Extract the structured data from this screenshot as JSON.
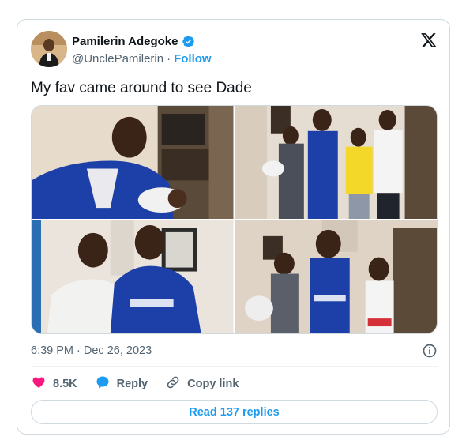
{
  "author": {
    "display_name": "Pamilerin Adegoke",
    "handle": "@UnclePamilerin",
    "separator": "·",
    "follow_label": "Follow",
    "verified": true
  },
  "tweet": {
    "text": "My fav came around to see Dade",
    "timestamp": "6:39 PM · Dec 26, 2023"
  },
  "media": {
    "photo_count": 4
  },
  "actions": {
    "like_count": "8.5K",
    "reply_label": "Reply",
    "copy_link_label": "Copy link"
  },
  "footer": {
    "read_replies_label": "Read 137 replies"
  },
  "colors": {
    "accent": "#1d9bf0",
    "like": "#f91880",
    "text_secondary": "#536471",
    "border": "#cfd9de"
  },
  "icons": [
    "verified-badge-icon",
    "x-logo-icon",
    "info-icon",
    "heart-icon",
    "reply-bubble-icon",
    "link-icon"
  ]
}
